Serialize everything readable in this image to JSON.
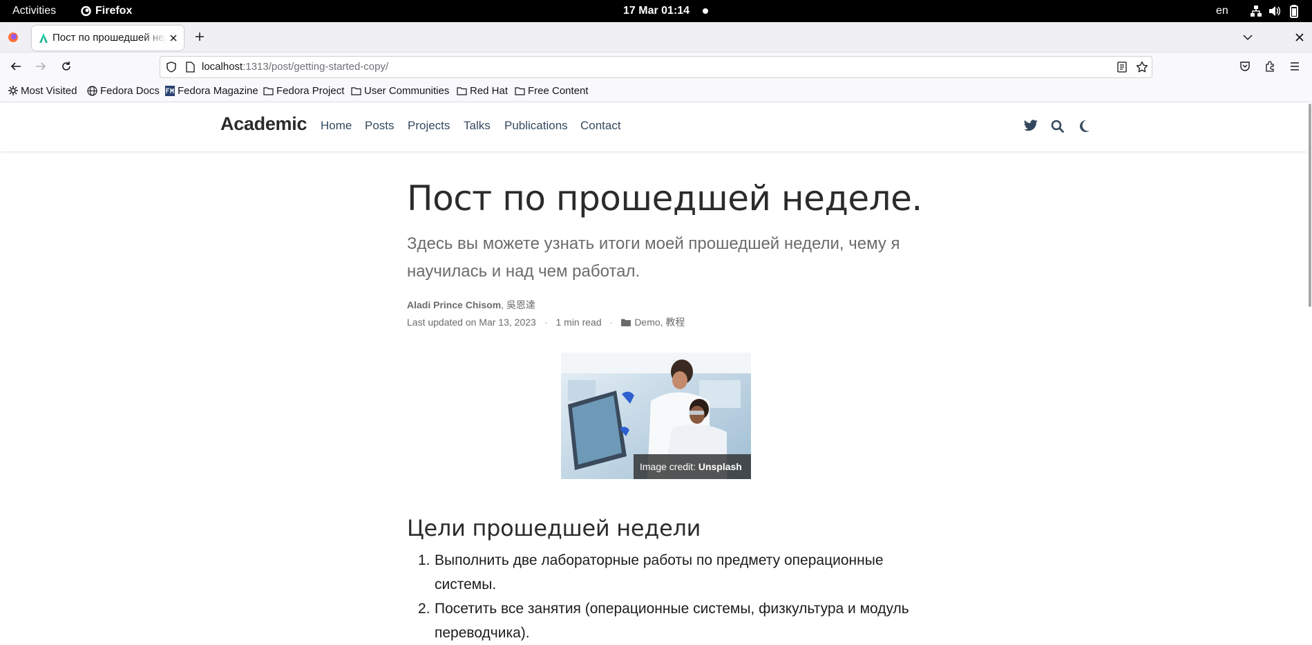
{
  "system_bar": {
    "activities": "Activities",
    "app": "Firefox",
    "datetime": "17 Mar  01:14",
    "lang": "en"
  },
  "browser": {
    "tab_title": "Пост по прошедшей неделе.",
    "url_host": "localhost",
    "url_path": ":1313/post/getting-started-copy/",
    "bookmarks": [
      {
        "label": "Most Visited",
        "icon": "gear-icon"
      },
      {
        "label": "Fedora Docs",
        "icon": "globe-icon"
      },
      {
        "label": "Fedora Magazine",
        "icon": "fm-icon"
      },
      {
        "label": "Fedora Project",
        "icon": "folder-icon"
      },
      {
        "label": "User Communities",
        "icon": "folder-icon"
      },
      {
        "label": "Red Hat",
        "icon": "folder-icon"
      },
      {
        "label": "Free Content",
        "icon": "folder-icon"
      }
    ]
  },
  "site": {
    "brand": "Academic",
    "nav": [
      "Home",
      "Posts",
      "Projects",
      "Talks",
      "Publications",
      "Contact"
    ]
  },
  "article": {
    "title": "Пост по прошедшей неделе.",
    "subtitle": "Здесь вы можете узнать итоги моей прошедшей недели, чему я научилась и над чем работал.",
    "author": "Aladi Prince Chisom",
    "coauthor": ", 吳恩達",
    "last_updated": "Last updated on Mar 13, 2023",
    "dot": "·",
    "read_time": "1 min read",
    "categories": "Demo, 教程",
    "credit_prefix": "Image credit: ",
    "credit_source": "Unsplash",
    "section_heading": "Цели прошедшей недели",
    "goals": [
      {
        "num": "1.",
        "text": "Выполнить две лабораторные работы по предмету операционные системы."
      },
      {
        "num": "2.",
        "text": "Посетить все занятия (операционные системы, физкультура и модуль переводчика)."
      }
    ]
  }
}
